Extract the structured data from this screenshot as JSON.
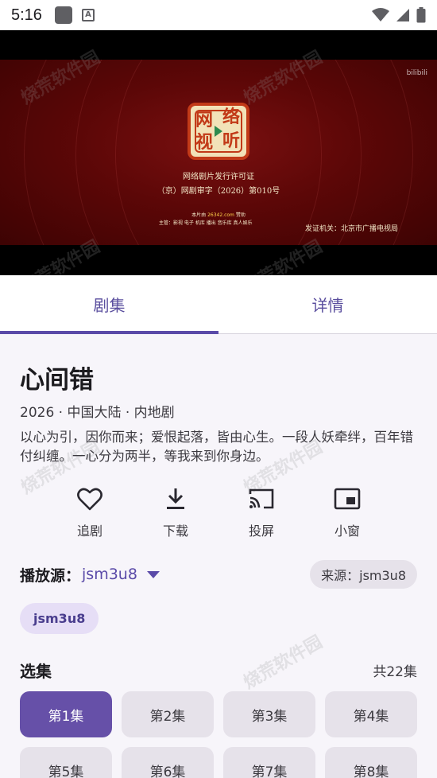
{
  "status_bar": {
    "time": "5:16",
    "notification_badge": "A"
  },
  "player": {
    "license_line1": "网络剧片发行许可证",
    "license_line2": "（京）网剧审字（2026）第010号",
    "credit_line1_prefix": "本片由",
    "credit_line1_url": "26342.com",
    "credit_line1_suffix": "赞助",
    "credit_line2": "主管：影视 电子 机库 播出 音乐库 真人娱乐",
    "issuer": "发证机关：北京市广播电视局",
    "corner_logo": "bilibili",
    "seal_glyphs": [
      "网",
      "络",
      "视",
      "听"
    ]
  },
  "watermark_text": "烧荒软件园",
  "tabs": [
    {
      "label": "剧集",
      "active": true
    },
    {
      "label": "详情",
      "active": false
    }
  ],
  "show": {
    "title": "心间错",
    "meta": "2026 · 中国大陆 · 内地剧",
    "description": "以心为引，因你而来；爱恨起落，皆由心生。一段人妖牵绊，百年错付纠缠。一心分为两半，等我来到你身边。"
  },
  "actions": [
    {
      "label": "追剧",
      "icon": "heart-icon"
    },
    {
      "label": "下载",
      "icon": "download-icon"
    },
    {
      "label": "投屏",
      "icon": "cast-icon"
    },
    {
      "label": "小窗",
      "icon": "picture-in-picture-icon"
    }
  ],
  "source": {
    "label": "播放源：",
    "value": "jsm3u8",
    "origin_chip": "来源：jsm3u8",
    "selected_chip": "jsm3u8"
  },
  "episodes": {
    "title": "选集",
    "count": "共22集",
    "items": [
      "第1集",
      "第2集",
      "第3集",
      "第4集",
      "第5集",
      "第6集",
      "第7集",
      "第8集"
    ],
    "active_index": 0
  },
  "colors": {
    "accent": "#5a4aa8",
    "active_episode": "#6650a8",
    "chip_bg": "#e6e2ea",
    "selected_chip_bg": "#e6def6"
  }
}
